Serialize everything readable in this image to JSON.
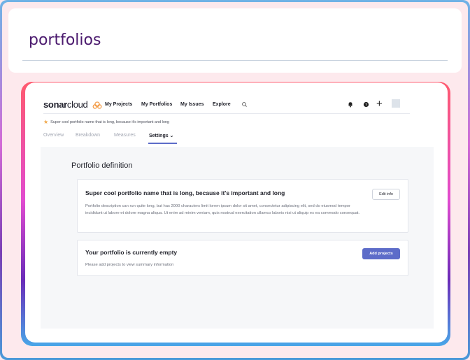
{
  "slide": {
    "title": "portfolios"
  },
  "app": {
    "logo_bold": "sonar",
    "logo_light": "cloud",
    "nav": [
      "My Projects",
      "My Portfolios",
      "My Issues",
      "Explore"
    ],
    "breadcrumb": "Super cool portfolio name that is long, because it's important and long",
    "tabs": [
      "Overview",
      "Breakdown",
      "Measures",
      "Settings ⌄"
    ],
    "active_tab": "Settings"
  },
  "page": {
    "section_title": "Portfolio definition",
    "definition_card": {
      "name": "Super cool portfolio name that is long, because it's important and long",
      "description": "Portfolio description can run quite long, but has 2000 characters limit lorem ipsum dolor sit amet, consectetur adipiscing elit, sed do eiusmod tempor incididunt ut labore et dolore magna aliqua. Ut enim ad minim veniam, quis nostrud exercitation ullamco laboris nisi ut aliquip ex ea commodo consequat.",
      "edit_label": "Edit info"
    },
    "empty_card": {
      "heading": "Your portfolio is currently empty",
      "message": "Please add projects to view summary information",
      "add_label": "Add projects"
    }
  },
  "colors": {
    "accent": "#5d6cc9",
    "title_text": "#4b1a6e",
    "background": "#fde8ec",
    "star": "#f0a84a"
  },
  "icons": [
    "sonarcloud-logo-icon",
    "search-icon",
    "bell-icon",
    "help-icon",
    "plus-icon",
    "avatar",
    "star-icon"
  ]
}
